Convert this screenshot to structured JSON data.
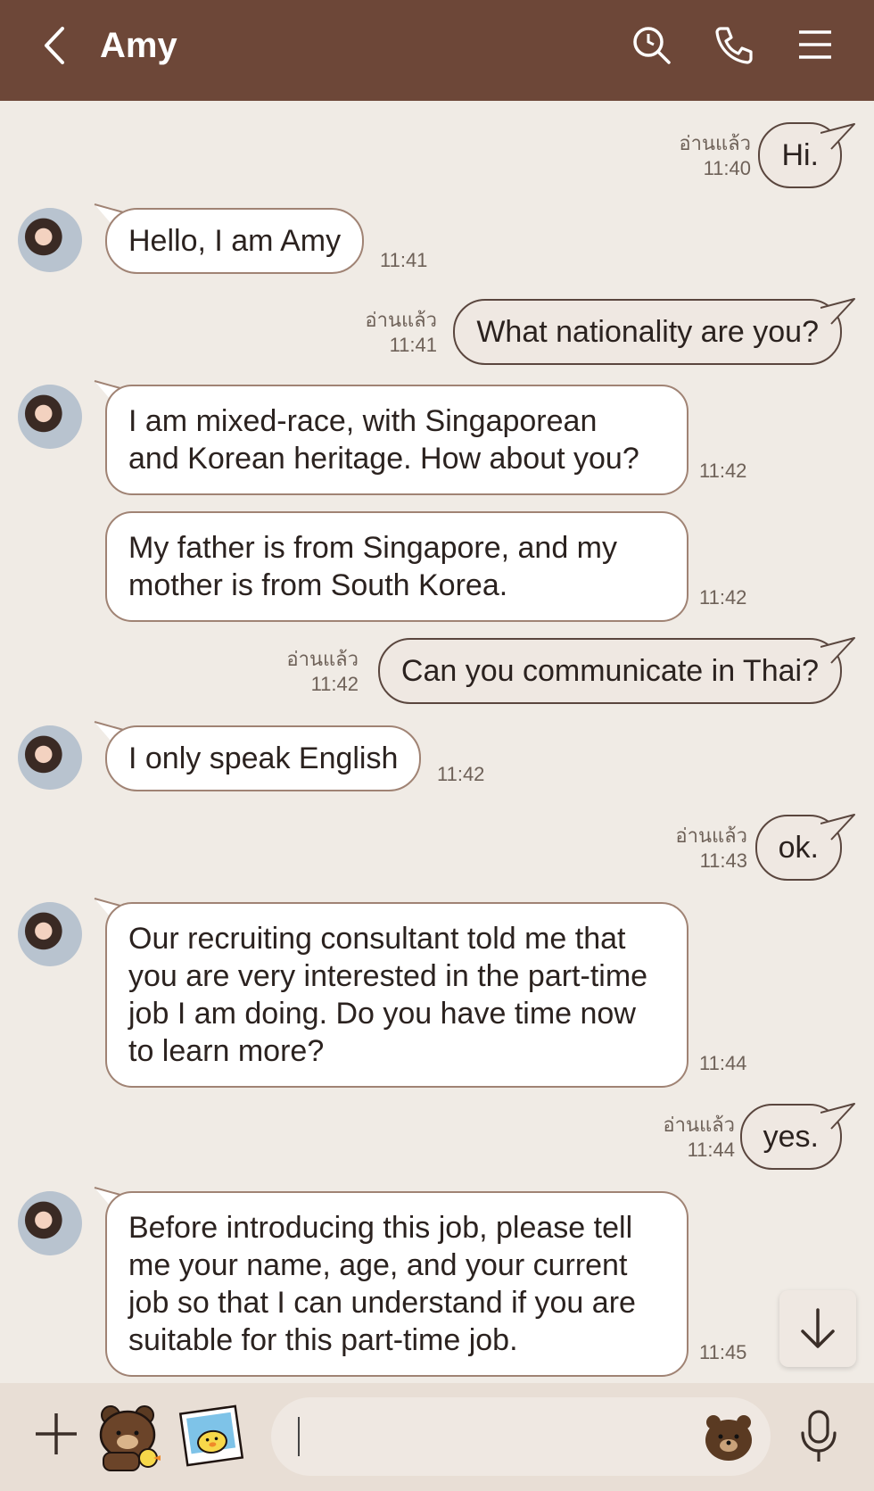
{
  "header": {
    "title": "Amy",
    "back_icon": "chevron-left-icon",
    "actions": [
      "search-icon",
      "phone-icon",
      "menu-icon"
    ],
    "color": "#6d4738"
  },
  "messages": [
    {
      "from": "me",
      "lines": [
        "Hi."
      ],
      "status": "อ่านแล้ว",
      "time": "11:40"
    },
    {
      "from": "amy",
      "lines": [
        "Hello, I am Amy"
      ],
      "time": "11:41"
    },
    {
      "from": "me",
      "lines": [
        "What nationality are you?"
      ],
      "status": "อ่านแล้ว",
      "time": "11:41"
    },
    {
      "from": "amy",
      "lines": [
        "I am mixed-race, with Singaporean",
        "and Korean heritage. How about you?"
      ],
      "time": "11:42"
    },
    {
      "from": "amy",
      "lines": [
        "My father is from Singapore, and my",
        "mother is from South Korea."
      ],
      "time": "11:42"
    },
    {
      "from": "me",
      "lines": [
        "Can you communicate in Thai?"
      ],
      "status": "อ่านแล้ว",
      "time": "11:42"
    },
    {
      "from": "amy",
      "lines": [
        "I only speak English"
      ],
      "time": "11:42"
    },
    {
      "from": "me",
      "lines": [
        "ok."
      ],
      "status": "อ่านแล้ว",
      "time": "11:43"
    },
    {
      "from": "amy",
      "lines": [
        "Our recruiting consultant told me that",
        "you are very interested in the part-time",
        "job I am doing. Do you have time now",
        "to learn more?"
      ],
      "time": "11:44"
    },
    {
      "from": "me",
      "lines": [
        "yes."
      ],
      "status": "อ่านแล้ว",
      "time": "11:44"
    },
    {
      "from": "amy",
      "lines": [
        "Before introducing this job, please tell",
        "me your name, age, and your current",
        "job so that I can understand if you are",
        "suitable for this part-time job."
      ],
      "time": "11:45"
    }
  ],
  "input": {
    "placeholder": "",
    "value": "",
    "icons": [
      "plus-icon",
      "bear-sticker-icon",
      "photo-sticker-icon",
      "bear-emoji-icon",
      "microphone-icon"
    ]
  },
  "colors": {
    "background": "#f0ebe5",
    "my_bubble": "#efe8e2",
    "their_bubble": "#ffffff",
    "bubble_border": "#a08374"
  }
}
